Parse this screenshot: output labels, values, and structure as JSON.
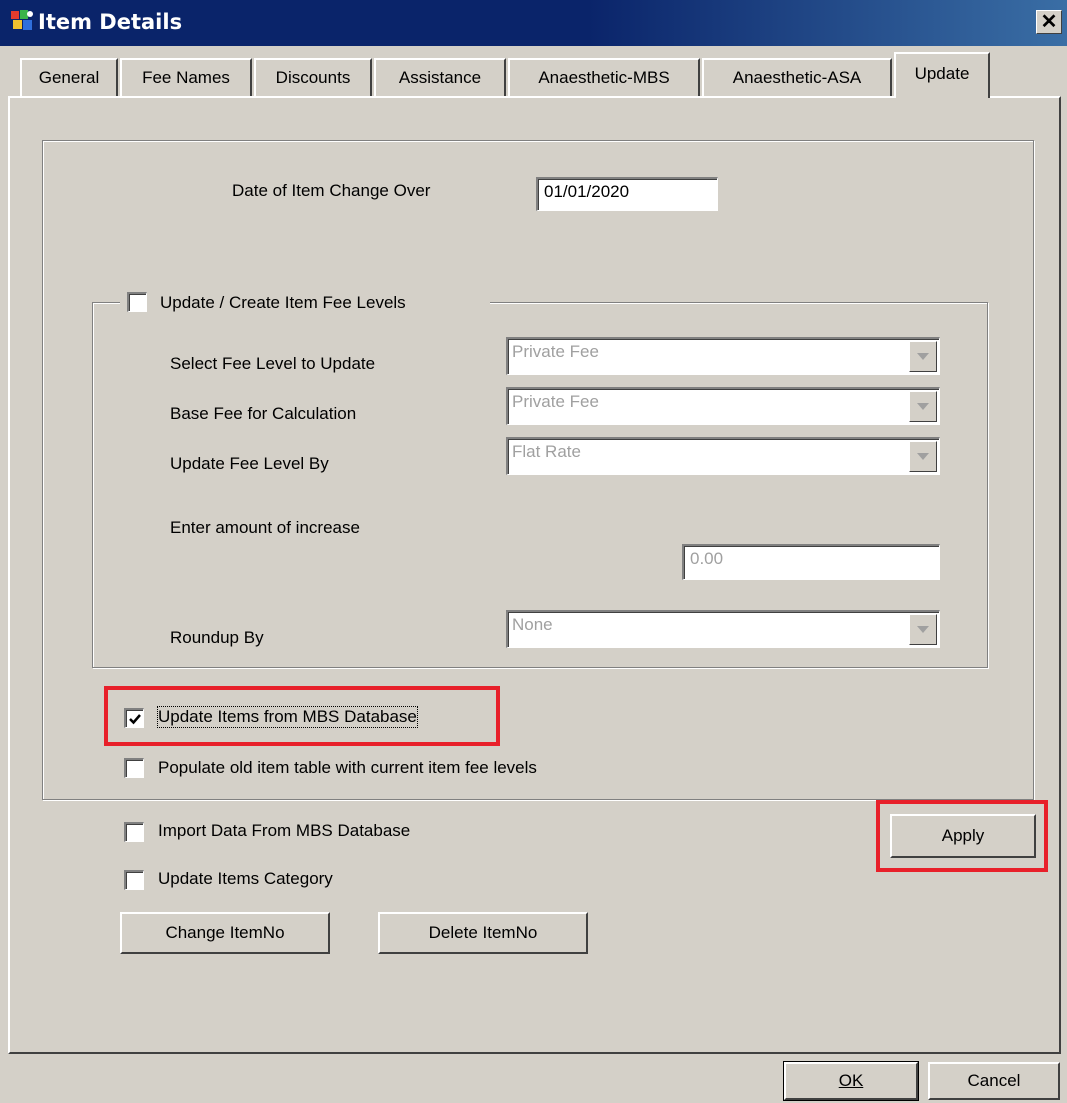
{
  "window": {
    "title": "Item Details",
    "close_glyph": "✕"
  },
  "tabs": [
    {
      "label": "General"
    },
    {
      "label": "Fee Names"
    },
    {
      "label": "Discounts"
    },
    {
      "label": "Assistance"
    },
    {
      "label": "Anaesthetic-MBS"
    },
    {
      "label": "Anaesthetic-ASA"
    },
    {
      "label": "Update",
      "active": true
    }
  ],
  "change_over": {
    "label": "Date of Item Change Over",
    "value": "01/01/2020"
  },
  "fee_levels": {
    "group_label": "Update / Create Item Fee Levels",
    "checked": false,
    "select_level_label": "Select Fee Level to Update",
    "select_level_value": "Private Fee",
    "base_fee_label": "Base Fee for Calculation",
    "base_fee_value": "Private Fee",
    "update_by_label": "Update Fee Level By",
    "update_by_value": "Flat Rate",
    "increase_label": "Enter amount of increase",
    "increase_value": "0.00",
    "roundup_label": "Roundup By",
    "roundup_value": "None"
  },
  "options": {
    "update_items_mbs": {
      "label": "Update Items from MBS Database",
      "checked": true
    },
    "populate_old": {
      "label": "Populate old item table with current item fee levels",
      "checked": false
    },
    "import_mbs": {
      "label": "Import Data From MBS Database",
      "checked": false
    },
    "update_category": {
      "label": "Update Items Category",
      "checked": false
    }
  },
  "buttons": {
    "apply": "Apply",
    "change_itemno": "Change ItemNo",
    "delete_itemno": "Delete ItemNo",
    "ok": "OK",
    "cancel": "Cancel"
  },
  "colors": {
    "highlight": "#e8202a",
    "titlebar": "#0a246a",
    "face": "#d4d0c8"
  }
}
